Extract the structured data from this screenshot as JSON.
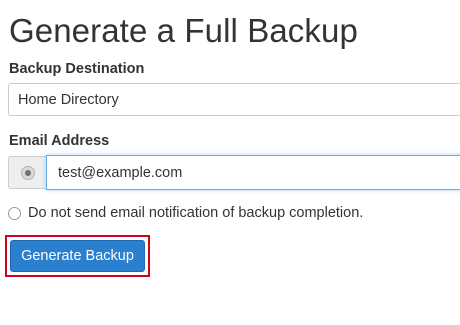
{
  "page": {
    "title": "Generate a Full Backup"
  },
  "form": {
    "destination_label": "Backup Destination",
    "destination_value": "Home Directory",
    "email_label": "Email Address",
    "email_value": "test@example.com",
    "no_email_option": "Do not send email notification of backup completion.",
    "submit_label": "Generate Backup"
  },
  "colors": {
    "primary_button": "#2b7fcf",
    "focus_border": "#66afe9",
    "highlight_outline": "#d0021b"
  },
  "icons": {
    "email_option_radio": "radio-selected-icon",
    "no_email_option_radio": "radio-unselected-icon"
  }
}
